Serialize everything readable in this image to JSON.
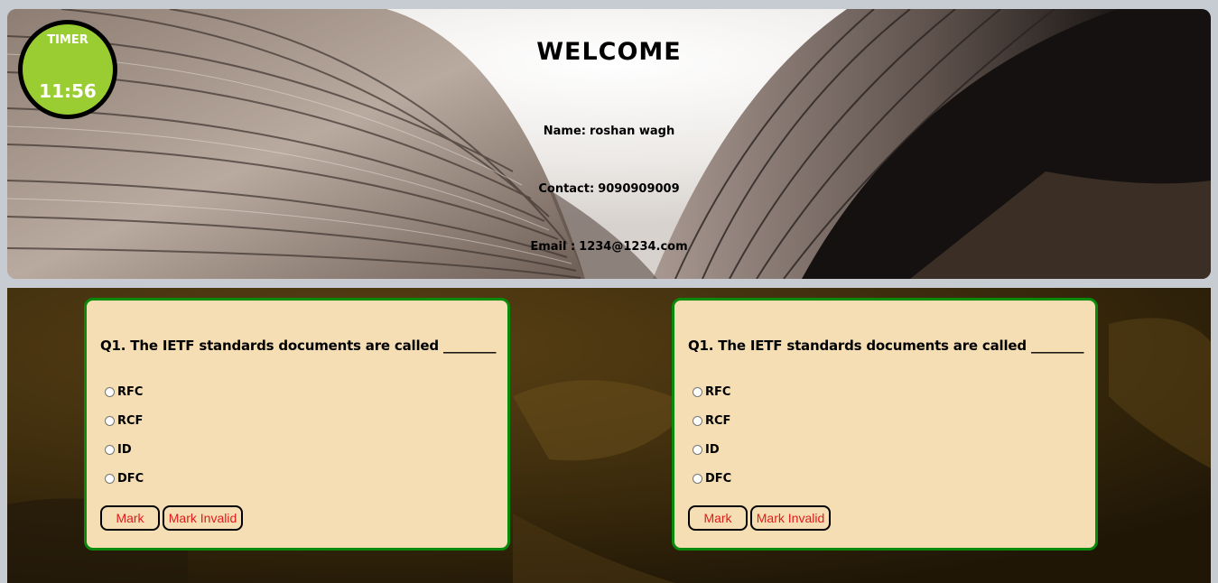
{
  "timer": {
    "label": "TIMER",
    "value": "11:56",
    "color": "#9acd32"
  },
  "header": {
    "title": "WELCOME",
    "name_label": "Name:",
    "name_value": "roshan wagh",
    "contact_label": "Contact:",
    "contact_value": "9090909009",
    "email_label": "Email :",
    "email_value": "1234@1234.com"
  },
  "questions": [
    {
      "text": "Q1. The IETF standards documents are called ________",
      "options": [
        "RFC",
        "RCF",
        "ID",
        "DFC"
      ],
      "mark_label": "Mark",
      "invalid_label": "Mark Invalid"
    },
    {
      "text": "Q1. The IETF standards documents are called ________",
      "options": [
        "RFC",
        "RCF",
        "ID",
        "DFC"
      ],
      "mark_label": "Mark",
      "invalid_label": "Mark Invalid"
    }
  ],
  "colors": {
    "card_background": "#f5deb3",
    "card_border": "#0a8a0a",
    "button_text": "#e01b1b"
  }
}
